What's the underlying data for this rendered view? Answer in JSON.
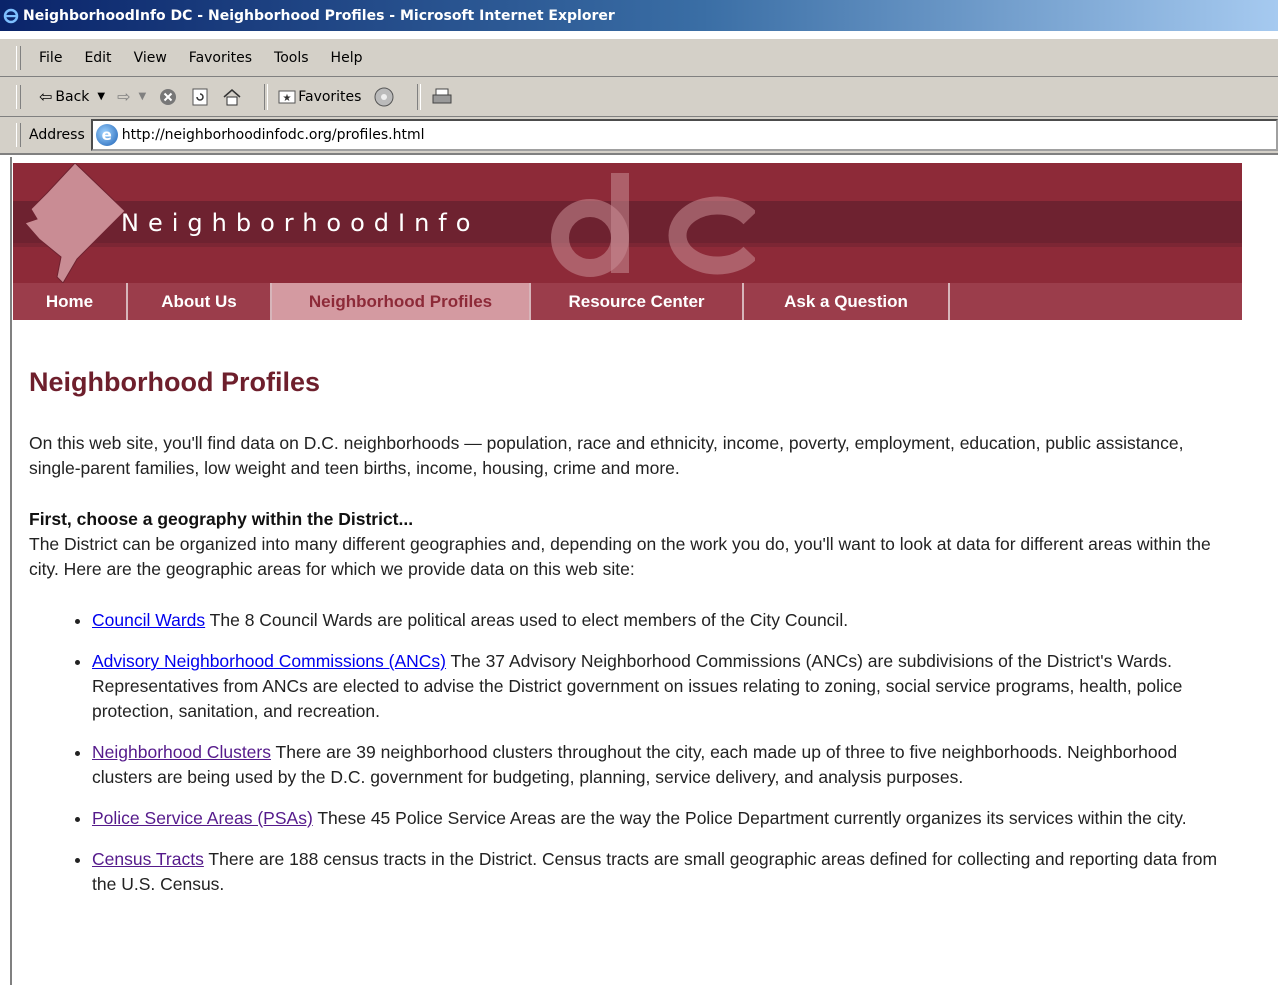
{
  "window": {
    "title": "NeighborhoodInfo DC - Neighborhood Profiles - Microsoft Internet Explorer"
  },
  "menu": [
    "File",
    "Edit",
    "View",
    "Favorites",
    "Tools",
    "Help"
  ],
  "toolbar": {
    "back_label": "Back",
    "favorites_label": "Favorites"
  },
  "address": {
    "label": "Address",
    "url": "http://neighborhoodinfodc.org/profiles.html"
  },
  "site": {
    "name": "NeighborhoodInfo",
    "logo_text": "dc",
    "colors": {
      "banner": "#8d2a38",
      "nav": "#9b3d4b",
      "active_nav": "#d49aa1"
    }
  },
  "nav": [
    {
      "label": "Home",
      "active": false
    },
    {
      "label": "About Us",
      "active": false
    },
    {
      "label": "Neighborhood Profiles",
      "active": true
    },
    {
      "label": "Resource Center",
      "active": false
    },
    {
      "label": "Ask a Question",
      "active": false
    }
  ],
  "page": {
    "title": "Neighborhood Profiles",
    "intro": "On this web site, you'll find data on D.C. neighborhoods — population, race and ethnicity, income, poverty, employment, education, public assistance, single-parent families, low weight and teen births, income, housing, crime and more.",
    "choose_heading": "First, choose a geography within the District...",
    "choose_text": "The District can be organized into many different geographies and, depending on the work you do, you'll want to look at data for different areas within the city. Here are the geographic areas for which we provide data on this web site:",
    "geographies": [
      {
        "link": "Council Wards",
        "text": " The 8 Council Wards are political areas used to elect members of the City Council.",
        "visited": false
      },
      {
        "link": "Advisory Neighborhood Commissions (ANCs)",
        "text": " The 37 Advisory Neighborhood Commissions (ANCs) are subdivisions of the District's Wards. Representatives from ANCs are elected to advise the District government on issues relating to zoning, social service programs, health, police protection, sanitation, and recreation.",
        "visited": false
      },
      {
        "link": "Neighborhood Clusters",
        "text": " There are 39 neighborhood clusters throughout the city, each made up of three to five neighborhoods. Neighborhood clusters are being used by the D.C. government for budgeting, planning, service delivery, and analysis purposes.",
        "visited": true
      },
      {
        "link": "Police Service Areas (PSAs)",
        "text": " These 45 Police Service Areas are the way the Police Department currently organizes its services within the city.",
        "visited": true
      },
      {
        "link": "Census Tracts",
        "text": " There are 188 census tracts in the District. Census tracts are small geographic areas defined for collecting and reporting data from the U.S. Census.",
        "visited": true
      }
    ]
  }
}
